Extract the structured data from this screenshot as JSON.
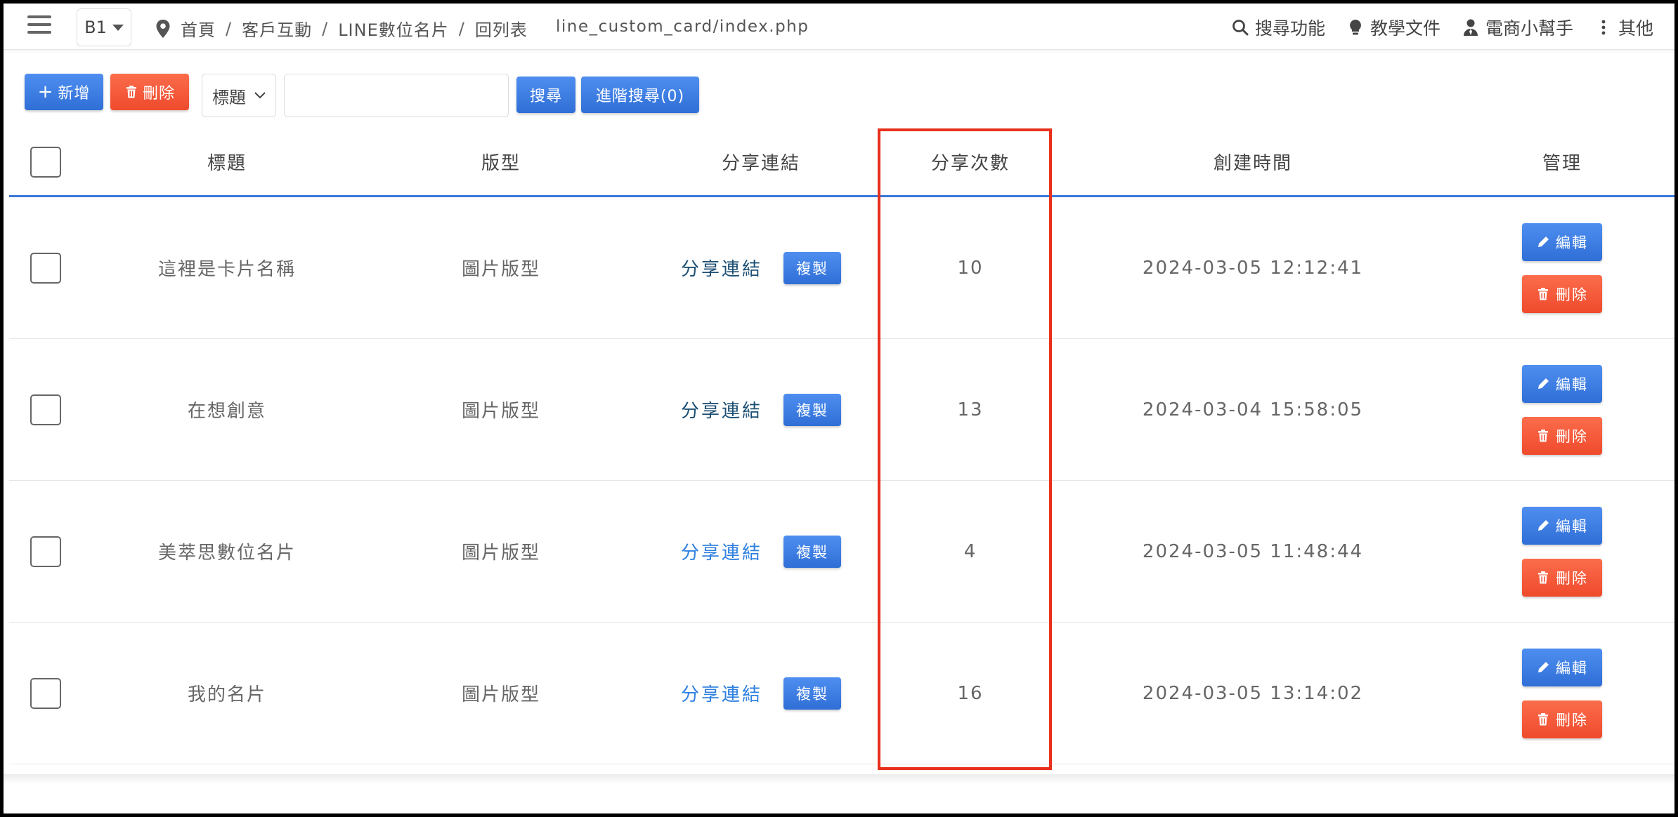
{
  "topbar": {
    "db_label": "B1",
    "breadcrumb": [
      "首頁",
      "客戶互動",
      "LINE數位名片",
      "回列表"
    ],
    "path": "line_custom_card/index.php",
    "nav": [
      {
        "label": "搜尋功能",
        "icon": "search-icon"
      },
      {
        "label": "教學文件",
        "icon": "lightbulb-icon"
      },
      {
        "label": "電商小幫手",
        "icon": "user-tie-icon"
      },
      {
        "label": "其他",
        "icon": "more-vertical-icon"
      }
    ]
  },
  "toolbar": {
    "add_label": "新增",
    "delete_label": "刪除",
    "field_select": "標題",
    "search_placeholder": "",
    "search_label": "搜尋",
    "advanced_label": "進階搜尋(0)"
  },
  "table": {
    "headers": [
      "標題",
      "版型",
      "分享連結",
      "分享次數",
      "創建時間",
      "管理"
    ],
    "rows": [
      {
        "title": "這裡是卡片名稱",
        "type": "圖片版型",
        "share": "分享連結",
        "count": "10",
        "created": "2024-03-05 12:12:41"
      },
      {
        "title": "在想創意",
        "type": "圖片版型",
        "share": "分享連結",
        "count": "13",
        "created": "2024-03-04 15:58:05"
      },
      {
        "title": "美萃思數位名片",
        "type": "圖片版型",
        "share": "分享連結",
        "count": "4",
        "created": "2024-03-05 11:48:44"
      },
      {
        "title": "我的名片",
        "type": "圖片版型",
        "share": "分享連結",
        "count": "16",
        "created": "2024-03-05 13:14:02"
      }
    ],
    "copy_label": "複製",
    "edit_label": "編輯",
    "row_delete_label": "刪除"
  },
  "colors": {
    "primary": "#2f6fd6",
    "danger": "#ef4a2c",
    "highlight": "#e8301c",
    "link_visited": "#1c4f74",
    "link": "#2f80e0"
  }
}
